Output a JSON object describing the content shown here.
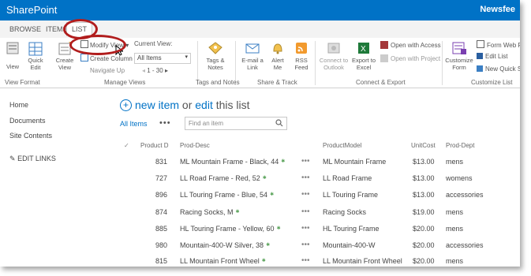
{
  "top_bar": {
    "brand": "SharePoint",
    "right_link": "Newsfee"
  },
  "tabs": [
    "BROWSE",
    "ITEMS",
    "LIST"
  ],
  "ribbon": {
    "view": "View",
    "quick_edit": "Quick\nEdit",
    "create_view": "Create\nView",
    "modify_view": "Modify View",
    "create_column": "Create Column",
    "navigate_up": "Navigate Up",
    "current_view_label": "Current View:",
    "current_view_value": "All Items",
    "paging": "1 - 30",
    "tags_notes": "Tags &\nNotes",
    "email_link": "E-mail a\nLink",
    "alert_me": "Alert\nMe",
    "rss_feed": "RSS\nFeed",
    "connect_outlook": "Connect to\nOutlook",
    "export_excel": "Export to\nExcel",
    "open_access": "Open with Access",
    "open_project": "Open with Project",
    "customize_form": "Customize\nForm",
    "form_web_parts": "Form Web P",
    "edit_list": "Edit List",
    "new_quick_step": "New Quick S",
    "groups": [
      "View Format",
      "Manage Views",
      "Tags and Notes",
      "Share & Track",
      "Connect & Export",
      "Customize List"
    ]
  },
  "left_nav": [
    "Home",
    "Documents",
    "Site Contents"
  ],
  "edit_links": "EDIT LINKS",
  "new_item": {
    "new": "new item",
    "or": "or",
    "edit": "edit",
    "rest": "this list"
  },
  "view_name": "All Items",
  "search_placeholder": "Find an item",
  "columns": [
    "Product D",
    "Prod-Desc",
    "ProductModel",
    "UnitCost",
    "Prod-Dept"
  ],
  "rows": [
    {
      "id": "831",
      "desc": "ML Mountain Frame - Black, 44",
      "model": "ML Mountain Frame",
      "cost": "$13.00",
      "dept": "mens"
    },
    {
      "id": "727",
      "desc": "LL Road Frame - Red, 52",
      "model": "LL Road Frame",
      "cost": "$13.00",
      "dept": "womens"
    },
    {
      "id": "896",
      "desc": "LL Touring Frame - Blue, 54",
      "model": "LL Touring Frame",
      "cost": "$13.00",
      "dept": "accessories"
    },
    {
      "id": "874",
      "desc": "Racing Socks, M",
      "model": "Racing Socks",
      "cost": "$19.00",
      "dept": "mens"
    },
    {
      "id": "885",
      "desc": "HL Touring Frame - Yellow, 60",
      "model": "HL Touring Frame",
      "cost": "$20.00",
      "dept": "mens"
    },
    {
      "id": "980",
      "desc": "Mountain-400-W Silver, 38",
      "model": "Mountain-400-W",
      "cost": "$20.00",
      "dept": "accessories"
    },
    {
      "id": "815",
      "desc": "LL Mountain Front Wheel",
      "model": "LL Mountain Front Wheel",
      "cost": "$20.00",
      "dept": "mens"
    }
  ],
  "colors": {
    "brand_blue": "#0072c6",
    "highlight_red": "#b11d1d"
  }
}
